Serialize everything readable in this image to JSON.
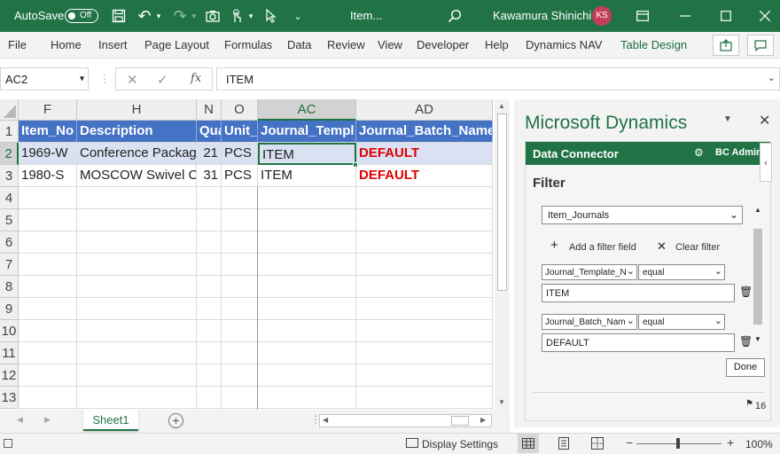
{
  "titlebar": {
    "autosave_label": "AutoSave",
    "autosave_state": "Off",
    "file_name": "Item...",
    "user_name": "Kawamura Shinichi",
    "user_initials": "KS"
  },
  "ribbon": {
    "tabs": [
      "File",
      "Home",
      "Insert",
      "Page Layout",
      "Formulas",
      "Data",
      "Review",
      "View",
      "Developer",
      "Help",
      "Dynamics NAV",
      "Table Design"
    ],
    "active_tab": "Table Design"
  },
  "formula_bar": {
    "name_box": "AC2",
    "fx": "fx",
    "content": "ITEM"
  },
  "grid": {
    "columns": [
      "F",
      "H",
      "N",
      "O",
      "AC",
      "AD"
    ],
    "rows": [
      "1",
      "2",
      "3",
      "4",
      "5",
      "6",
      "7",
      "8",
      "9",
      "10",
      "11",
      "12",
      "13"
    ],
    "header_row": [
      "Item_No",
      "Description",
      "Quantity",
      "Unit_",
      "Journal_Templ",
      "Journal_Batch_Name"
    ],
    "data_rows": [
      [
        "1969-W",
        "Conference Packag",
        "21",
        "PCS",
        "ITEM",
        "DEFAULT"
      ],
      [
        "1980-S",
        "MOSCOW Swivel C",
        "31",
        "PCS",
        "ITEM",
        "DEFAULT"
      ]
    ]
  },
  "sheets": {
    "tabs": [
      "Sheet1"
    ]
  },
  "status": {
    "display_settings": "Display Settings",
    "zoom": "100%"
  },
  "pane": {
    "title": "Microsoft Dynamics",
    "connector_title": "Data Connector",
    "user": "BC Admin",
    "section": "Filter",
    "table_select": "Item_Journals",
    "add_filter": "Add a filter field",
    "clear_filter": "Clear filter",
    "filters": [
      {
        "field": "Journal_Template_N",
        "op": "equal",
        "value": "ITEM"
      },
      {
        "field": "Journal_Batch_Nam",
        "op": "equal",
        "value": "DEFAULT"
      }
    ],
    "done": "Done",
    "footer_count": "16"
  },
  "colors": {
    "excel_green": "#217346",
    "header_blue": "#4472c4",
    "default_red": "#e00000"
  }
}
